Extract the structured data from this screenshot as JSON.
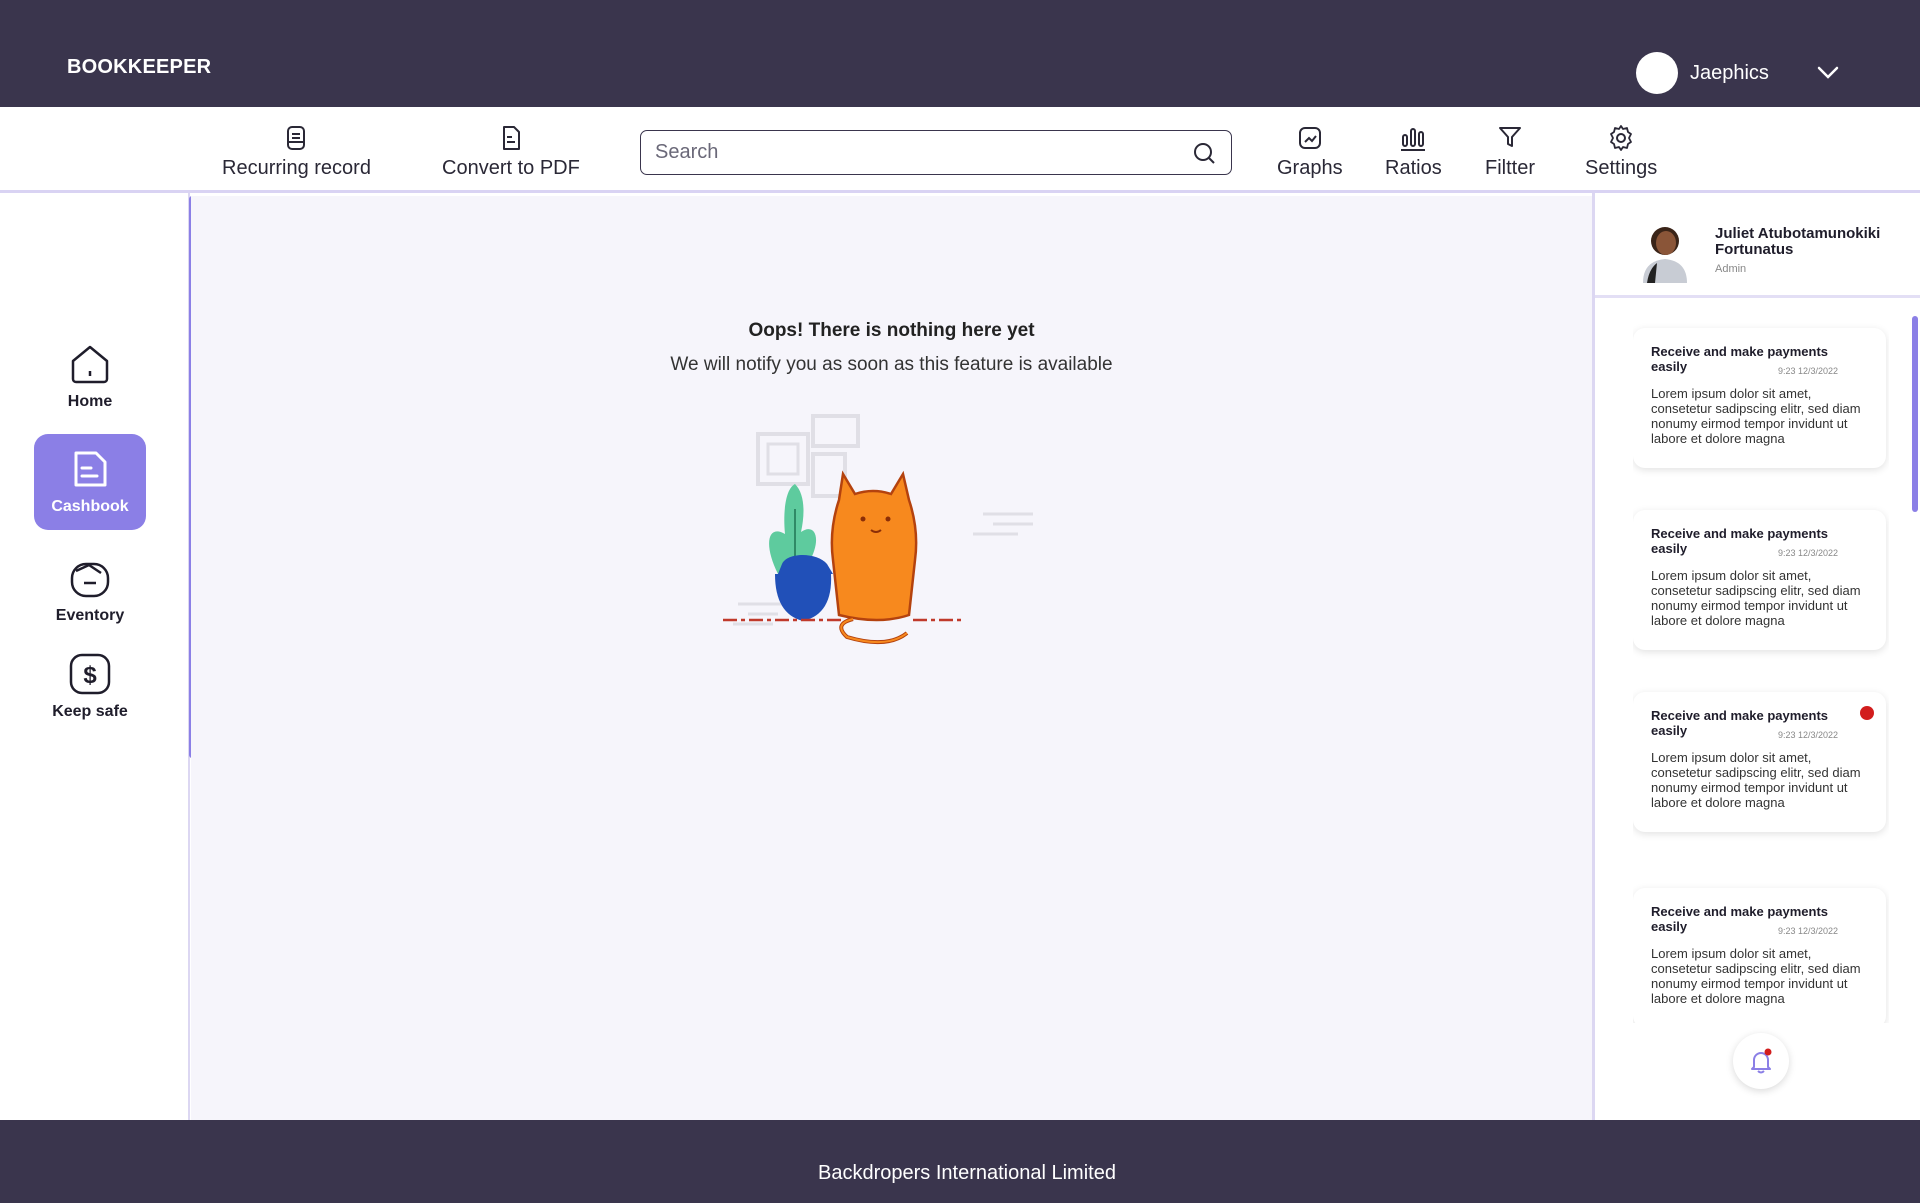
{
  "header": {
    "brand": "BOOKKEEPER",
    "user_name": "Jaephics"
  },
  "toolbar": {
    "recurring_label": "Recurring record",
    "pdf_label": "Convert to PDF",
    "search_placeholder": "Search",
    "graphs_label": "Graphs",
    "ratios_label": "Ratios",
    "filter_label": "Filtter",
    "settings_label": "Settings"
  },
  "sidebar": {
    "items": [
      {
        "label": "Home",
        "icon": "home-icon"
      },
      {
        "label": "Cashbook",
        "icon": "cashbook-icon",
        "active": true
      },
      {
        "label": "Eventory",
        "icon": "inventory-icon"
      },
      {
        "label": "Keep safe",
        "icon": "dollar-icon"
      }
    ]
  },
  "main": {
    "empty_title": "Oops! There is nothing here yet",
    "empty_subtitle": "We will notify you as soon as this feature is available"
  },
  "profile": {
    "name": "Juliet Atubotamunokiki Fortunatus",
    "role": "Admin"
  },
  "notifications": [
    {
      "title": "Receive and make payments easily",
      "time": "9:23  12/3/2022",
      "body": "Lorem ipsum dolor sit amet, consetetur sadipscing elitr, sed diam nonumy eirmod tempor invidunt ut labore et dolore magna",
      "unread": false
    },
    {
      "title": "Receive and make payments easily",
      "time": "9:23  12/3/2022",
      "body": "Lorem ipsum dolor sit amet, consetetur sadipscing elitr, sed diam nonumy eirmod tempor invidunt ut labore et dolore magna",
      "unread": false
    },
    {
      "title": "Receive and make payments easily",
      "time": "9:23  12/3/2022",
      "body": "Lorem ipsum dolor sit amet, consetetur sadipscing elitr, sed diam nonumy eirmod tempor invidunt ut labore et dolore magna",
      "unread": true
    },
    {
      "title": "Receive and make payments easily",
      "time": "9:23  12/3/2022",
      "body": "Lorem ipsum dolor sit amet, consetetur sadipscing elitr, sed diam nonumy eirmod tempor invidunt ut labore et dolore magna",
      "unread": false
    }
  ],
  "footer": {
    "text": "Backdropers International Limited"
  },
  "colors": {
    "dark": "#3a354d",
    "accent": "#8b7fe6",
    "background": "#f6f5fb",
    "unread_dot": "#d21d1d"
  }
}
